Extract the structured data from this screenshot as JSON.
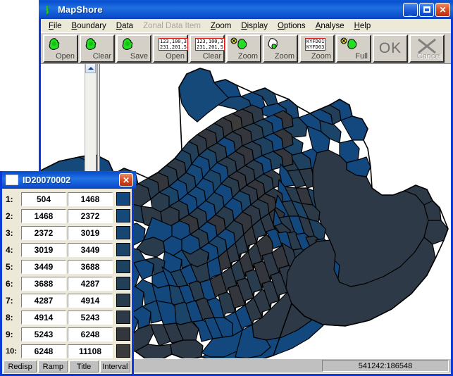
{
  "app": {
    "title": "MapShore",
    "icon": "map-outline-icon"
  },
  "titlebar": {
    "minimize_label": "_",
    "maximize_label": "□",
    "close_label": "✕"
  },
  "menu": {
    "items": [
      {
        "label": "File",
        "accel": "F",
        "disabled": false
      },
      {
        "label": "Boundary",
        "accel": "B",
        "disabled": false
      },
      {
        "label": "Data",
        "accel": "D",
        "disabled": false
      },
      {
        "label": "Zonal Data Item",
        "accel": "I",
        "disabled": true
      },
      {
        "label": "Zoom",
        "accel": "Z",
        "disabled": false
      },
      {
        "label": "Display",
        "accel": "D",
        "disabled": false
      },
      {
        "label": "Options",
        "accel": "O",
        "disabled": false
      },
      {
        "label": "Analyse",
        "accel": "A",
        "disabled": false
      },
      {
        "label": "Help",
        "accel": "H",
        "disabled": false
      }
    ]
  },
  "toolbar": {
    "buttons": [
      {
        "name": "boundary-open",
        "label": "Open",
        "icon": "green-blob-icon",
        "disabled": false,
        "code": null
      },
      {
        "name": "boundary-clear",
        "label": "Clear",
        "icon": "green-blob-icon",
        "disabled": false,
        "code": null
      },
      {
        "name": "boundary-save",
        "label": "Save",
        "icon": "green-blob-icon",
        "disabled": false,
        "code": null
      },
      {
        "name": "data-open",
        "label": "Open",
        "icon": "data-code-icon",
        "disabled": false,
        "code": [
          "123,100,3",
          "231,201,5"
        ]
      },
      {
        "name": "data-clear",
        "label": "Clear",
        "icon": "data-code-icon",
        "disabled": false,
        "code": [
          "123,100,3",
          "231,201,5"
        ]
      },
      {
        "name": "zoom-select",
        "label": "Zoom",
        "icon": "blob-magnify-icon",
        "disabled": false,
        "code": null
      },
      {
        "name": "zoom-outline",
        "label": "Zoom",
        "icon": "outline-blob-icon",
        "disabled": false,
        "code": null
      },
      {
        "name": "zoom-zone",
        "label": "Zoom",
        "icon": "zone-code-icon",
        "disabled": false,
        "code": [
          "KYFD01",
          "KYFD03"
        ]
      },
      {
        "name": "zoom-full",
        "label": "Full",
        "icon": "blob-full-icon",
        "disabled": false,
        "code": null
      },
      {
        "name": "ok",
        "label": "OK",
        "icon": "ok-text-icon",
        "disabled": false,
        "code": null
      },
      {
        "name": "cancel",
        "label": "Cancel",
        "icon": "cross-icon",
        "disabled": true,
        "code": null
      }
    ]
  },
  "statusbar": {
    "coordinates": "541242:186548"
  },
  "scrollbar": {
    "up_arrow": "scroll-up-arrow-icon"
  },
  "legend_dialog": {
    "title": "ID20070002",
    "close_label": "✕",
    "buttons": [
      {
        "name": "redisp",
        "label": "Redisp"
      },
      {
        "name": "ramp",
        "label": "Ramp"
      },
      {
        "name": "title",
        "label": "Title"
      },
      {
        "name": "interval",
        "label": "Interval"
      }
    ],
    "rows": [
      {
        "index": "1:",
        "low": "504",
        "high": "1468",
        "color": "#12487e"
      },
      {
        "index": "2:",
        "low": "1468",
        "high": "2372",
        "color": "#14497a"
      },
      {
        "index": "3:",
        "low": "2372",
        "high": "3019",
        "color": "#164671"
      },
      {
        "index": "4:",
        "low": "3019",
        "high": "3449",
        "color": "#1a4468"
      },
      {
        "index": "5:",
        "low": "3449",
        "high": "3688",
        "color": "#1e4160"
      },
      {
        "index": "6:",
        "low": "3688",
        "high": "4287",
        "color": "#233e57"
      },
      {
        "index": "7:",
        "low": "4287",
        "high": "4914",
        "color": "#283c4e"
      },
      {
        "index": "8:",
        "low": "4914",
        "high": "5243",
        "color": "#2d3946"
      },
      {
        "index": "9:",
        "low": "5243",
        "high": "6248",
        "color": "#33373d"
      },
      {
        "index": "10:",
        "low": "6248",
        "high": "11108",
        "color": "#3b3b3b"
      }
    ]
  },
  "map": {
    "background": "#ffffff",
    "stroke": "#000000",
    "palette": [
      "#12487e",
      "#14497a",
      "#164671",
      "#1a4468",
      "#1e4160",
      "#233e57",
      "#283c4e",
      "#2d3946",
      "#33373d",
      "#3b3b3b"
    ],
    "outline_color": "#000000",
    "description": "choropleth map of administrative zones"
  }
}
